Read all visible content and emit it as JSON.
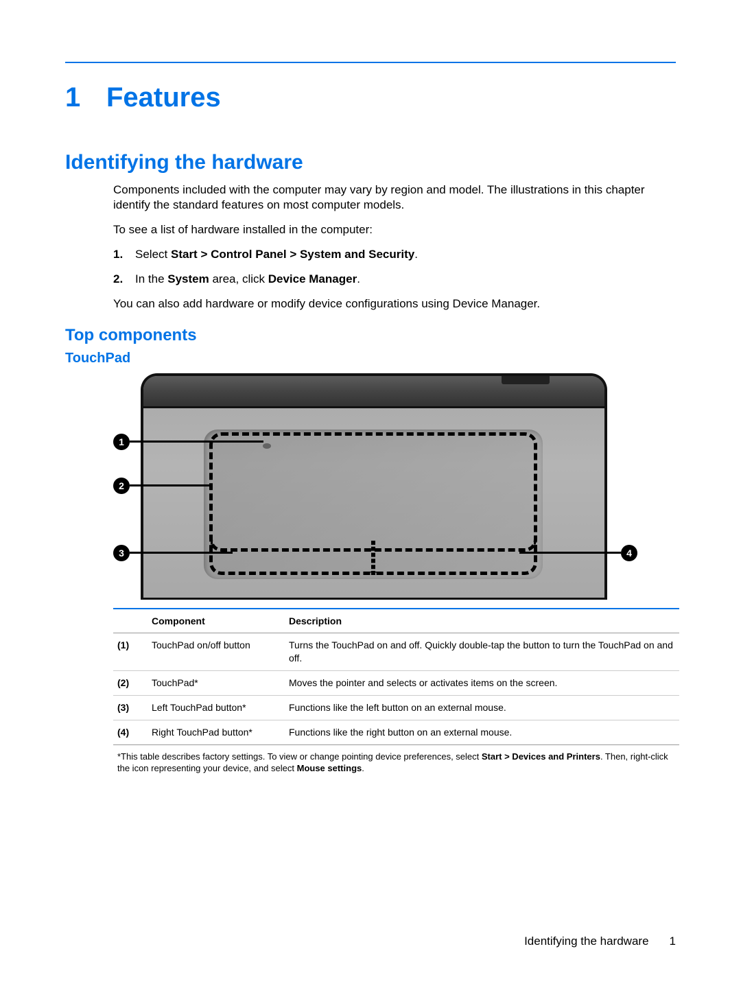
{
  "chapter": {
    "num": "1",
    "title": "Features"
  },
  "h2": "Identifying the hardware",
  "intro": [
    "Components included with the computer may vary by region and model. The illustrations in this chapter identify the standard features on most computer models.",
    "To see a list of hardware installed in the computer:"
  ],
  "steps": [
    {
      "num": "1.",
      "prefix": "Select ",
      "bold": "Start > Control Panel > System and Security",
      "suffix": "."
    },
    {
      "num": "2.",
      "prefix": "In the ",
      "bold": "System",
      "mid": " area, click ",
      "bold2": "Device Manager",
      "suffix": "."
    }
  ],
  "postStep": "You can also add hardware or modify device configurations using Device Manager.",
  "h3": "Top components",
  "h4": "TouchPad",
  "callouts": [
    "1",
    "2",
    "3",
    "4"
  ],
  "table": {
    "headers": [
      "Component",
      "Description"
    ],
    "rows": [
      {
        "idx": "(1)",
        "comp": "TouchPad on/off button",
        "desc": "Turns the TouchPad on and off. Quickly double-tap the button to turn the TouchPad on and off."
      },
      {
        "idx": "(2)",
        "comp": "TouchPad*",
        "desc": "Moves the pointer and selects or activates items on the screen."
      },
      {
        "idx": "(3)",
        "comp": "Left TouchPad button*",
        "desc": "Functions like the left button on an external mouse."
      },
      {
        "idx": "(4)",
        "comp": "Right TouchPad button*",
        "desc": "Functions like the right button on an external mouse."
      }
    ],
    "footnote": {
      "a": "*This table describes factory settings. To view or change pointing device preferences, select ",
      "b1": "Start > Devices and Printers",
      "b": ". Then, right-click the icon representing your device, and select ",
      "b2": "Mouse settings",
      "c": "."
    }
  },
  "footer": {
    "section": "Identifying the hardware",
    "page": "1"
  }
}
